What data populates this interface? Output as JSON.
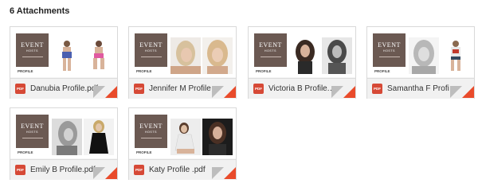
{
  "header": {
    "title": "6 Attachments"
  },
  "colors": {
    "logo_bg": "#6b5952",
    "pdf_red": "#d64936",
    "corner_orange": "#e94b2b"
  },
  "attachments": [
    {
      "filename": "Danubia Profile.pdf",
      "type_badge": "PDF",
      "logo_text": "EVENT",
      "logo_sub": "HOSTS",
      "profile_label": "PROFILE",
      "icon": "pdf-icon"
    },
    {
      "filename": "Jennifer M Profile.pdf",
      "type_badge": "PDF",
      "logo_text": "EVENT",
      "logo_sub": "HOSTS",
      "profile_label": "PROFILE",
      "icon": "pdf-icon"
    },
    {
      "filename": "Victoria B Profile.pdf",
      "type_badge": "PDF",
      "logo_text": "EVENT",
      "logo_sub": "HOSTS",
      "profile_label": "PROFILE",
      "icon": "pdf-icon"
    },
    {
      "filename": "Samantha F Profile.pdf",
      "type_badge": "PDF",
      "logo_text": "EVENT",
      "logo_sub": "HOSTS",
      "profile_label": "PROFILE",
      "icon": "pdf-icon"
    },
    {
      "filename": "Emily B Profile.pdf",
      "type_badge": "PDF",
      "logo_text": "EVENT",
      "logo_sub": "HOSTS",
      "profile_label": "PROFILE",
      "icon": "pdf-icon"
    },
    {
      "filename": "Katy Profile .pdf",
      "type_badge": "PDF",
      "logo_text": "EVENT",
      "logo_sub": "HOSTS",
      "profile_label": "PROFILE",
      "icon": "pdf-icon"
    }
  ]
}
